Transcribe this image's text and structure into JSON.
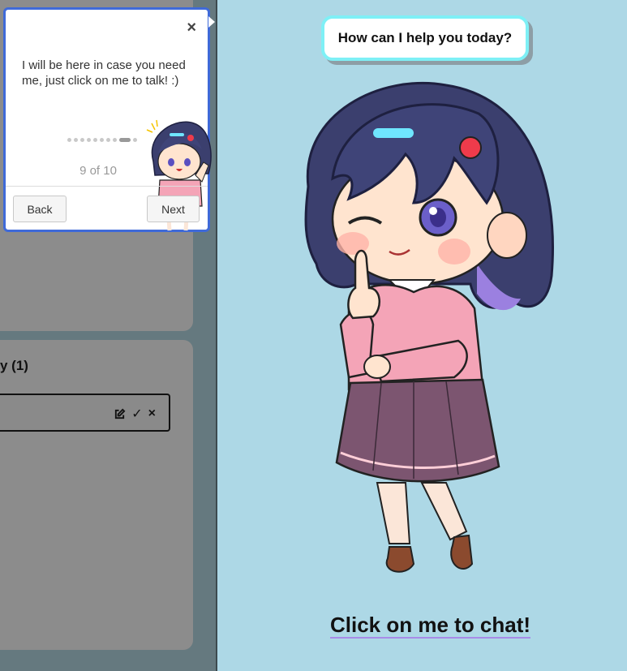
{
  "left_panel": {
    "section_heading": "y (1)",
    "row_actions": {
      "edit_icon": "edit-icon",
      "check_glyph": "✓",
      "close_glyph": "×"
    }
  },
  "tour_popup": {
    "close_glyph": "×",
    "message": "I will be here in case you need me, just click on me to talk! :)",
    "step_counter": "9 of 10",
    "current_step": 9,
    "total_steps": 10,
    "back_label": "Back",
    "next_label": "Next"
  },
  "assistant": {
    "speech_bubble": "How can I help you today?",
    "call_to_action": "Click on me to chat!"
  },
  "colors": {
    "background": "#add8e6",
    "popup_border": "#3f6ad8",
    "bubble_border": "#7ef0f6",
    "overlay": "#65797f"
  }
}
